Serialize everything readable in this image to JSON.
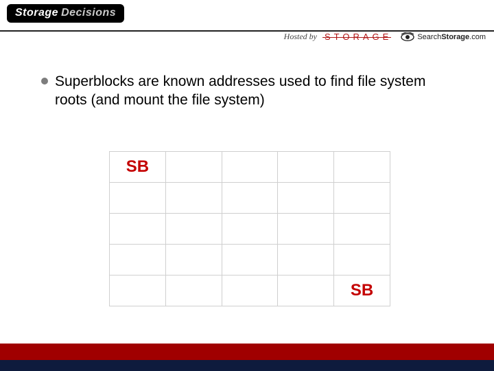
{
  "header": {
    "logo_word1": "Storage",
    "logo_word2": "Decisions",
    "hosted_by_label": "Hosted by",
    "sponsor_storage": "STORAGE",
    "search_brand_prefix": "Search",
    "search_brand_bold": "Storage",
    "search_brand_suffix": ".com"
  },
  "content": {
    "bullet_text": "Superblocks are known addresses used to find file system roots (and mount the file system)",
    "sb_label": "SB",
    "grid": {
      "rows": 5,
      "cols": 5,
      "sb_cells": [
        [
          0,
          0
        ],
        [
          4,
          4
        ]
      ]
    }
  },
  "colors": {
    "accent_red": "#c40000",
    "footer_red": "#a00000",
    "footer_navy": "#0e1b3d",
    "bullet_gray": "#7d7d7d",
    "grid_border": "#cfcfcf"
  }
}
